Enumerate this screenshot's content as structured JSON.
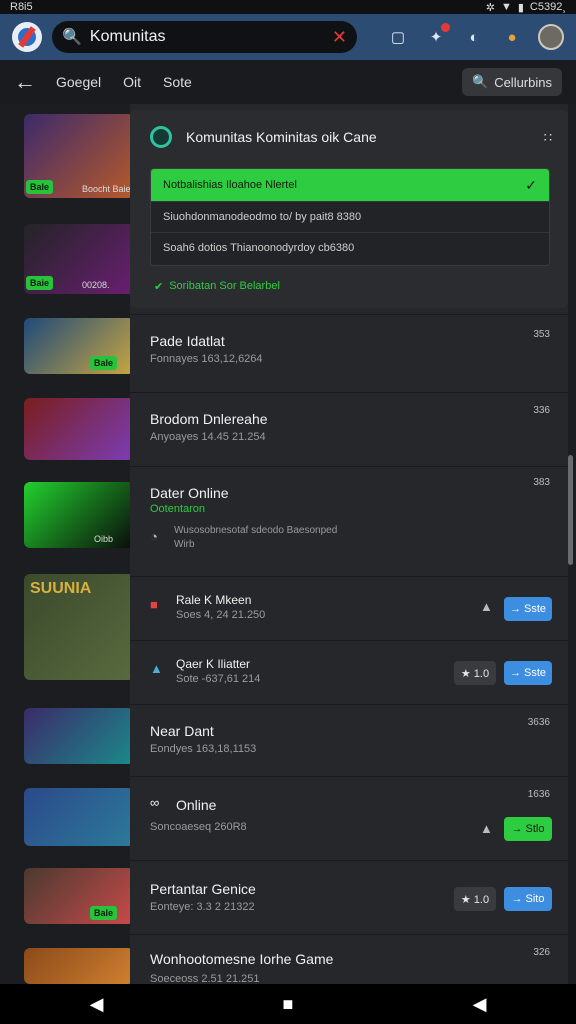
{
  "status": {
    "left": "R8i5",
    "right": "C5392¸"
  },
  "appbar": {
    "search_value": "Komunitas"
  },
  "subbar": {
    "tabs": [
      "Goegel",
      "Oit",
      "Sote"
    ],
    "community_button": "Cellurbins"
  },
  "thumbs": [
    {
      "badge": "Bale",
      "meta": "Boocht Baie",
      "colors": [
        "#3c2a6b",
        "#b85a2a"
      ]
    },
    {
      "badge": "Baie",
      "meta": "00208.",
      "colors": [
        "#232426",
        "#6a1e72"
      ]
    },
    {
      "badge": "Bale",
      "meta": "",
      "colors": [
        "#1f4a7a",
        "#c9a640"
      ]
    },
    {
      "badge": "",
      "meta": "",
      "colors": [
        "#7a1e1e",
        "#7b3db5"
      ]
    },
    {
      "badge": "",
      "meta": "Oibb",
      "colors": [
        "#22d12f",
        "#0a0a0a"
      ]
    },
    {
      "badge": "",
      "meta": "SUUNIA",
      "colors": [
        "#3a4a2c",
        "#5a6a3e"
      ]
    },
    {
      "badge": "",
      "meta": "",
      "colors": [
        "#3b2b6a",
        "#1b8a8a"
      ]
    },
    {
      "badge": "",
      "meta": "",
      "colors": [
        "#2b4a8a",
        "#2d7a9a"
      ]
    },
    {
      "badge": "Bale",
      "meta": "",
      "colors": [
        "#4a3a30",
        "#c94a4a"
      ]
    },
    {
      "badge": "",
      "meta": "",
      "colors": [
        "#8a4a1a",
        "#d08030"
      ]
    }
  ],
  "card_top": {
    "title": "Komunitas Kominitas oik Cane",
    "dropdown_selected": "Notbalishias Iloahoe Nlertel",
    "option1": "Siuohdonmanodeodmo to/ by pait8 8380",
    "option2": "Soah6 dotios Thianoonodyrdoy cb6380",
    "ok_text": "Soribatan Sor Belarbel"
  },
  "rows": [
    {
      "name": "Pade Idatlat",
      "sub": "Fonnayes 163,12,6264",
      "num": "353"
    },
    {
      "name": "Brodom Dnlereahe",
      "sub": "Anyoayes 14.45 21.254",
      "num": "336"
    },
    {
      "name": "Dater Online",
      "sub": "Ootentaron",
      "extra": "Wusosobnesotaf sdeodo Baesonped",
      "extra2": "Wirb",
      "num": "383"
    },
    {
      "name": "Rale K Mkeen",
      "sub": "Soes 4, 24 21.250",
      "button": "Sste"
    },
    {
      "name": "Qaer K Iliatter",
      "sub": "Sote -637,61 214",
      "tag": "★ 1.0",
      "button": "Sste"
    },
    {
      "name": "Near Dant",
      "sub": "Eondyes 163,18,1153",
      "num": "3636"
    },
    {
      "name": "Online",
      "sub": "Soncoaeseq 260R8",
      "num": "1636",
      "button": "Stlo"
    },
    {
      "name": "Pertantar Genice",
      "sub": "Eonteye: 3.3 2 21322",
      "tag": "★ 1.0",
      "button": "Sito"
    },
    {
      "name": "Wonhootomesne Iorhe Game",
      "sub": "Soeceoss 2.51 21.251",
      "num": "326"
    }
  ],
  "colors": {
    "accent_green": "#2ecc40",
    "accent_blue": "#3d8ee0",
    "appbar": "#2c4c74"
  }
}
